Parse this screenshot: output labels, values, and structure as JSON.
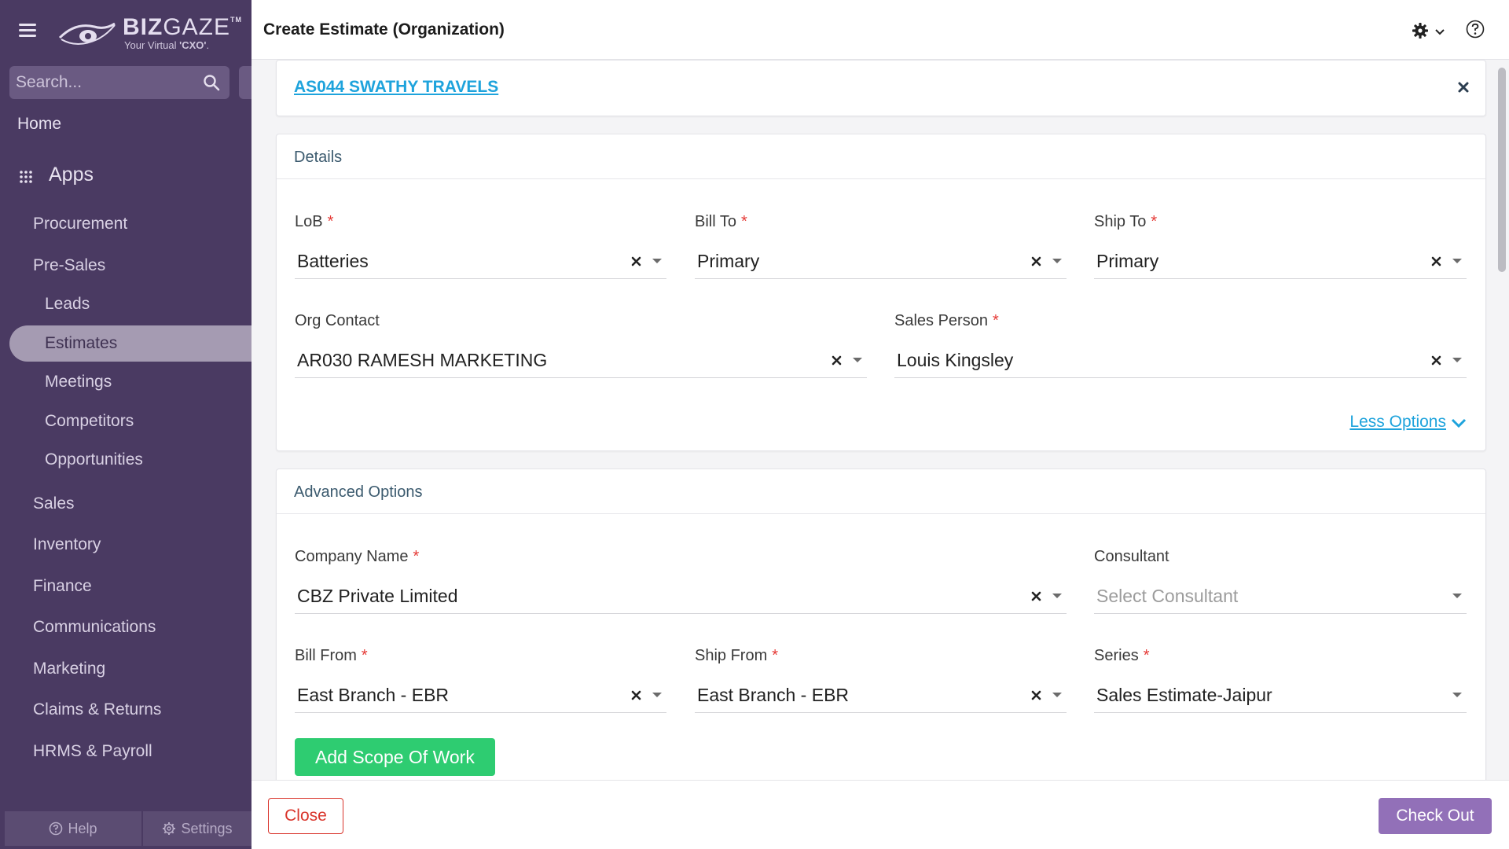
{
  "sidebar": {
    "brand_bold": "BIZ",
    "brand_light": "GAZE",
    "brand_tm": "TM",
    "tagline_prefix": "Your Virtual ",
    "tagline_emph": "'CXO'",
    "tagline_suffix": ".",
    "search_placeholder": "Search...",
    "home": "Home",
    "apps": "Apps",
    "items": {
      "procurement": "Procurement",
      "presales": "Pre-Sales",
      "leads": "Leads",
      "estimates": "Estimates",
      "meetings": "Meetings",
      "competitors": "Competitors",
      "opportunities": "Opportunities",
      "sales": "Sales",
      "inventory": "Inventory",
      "finance": "Finance",
      "communications": "Communications",
      "marketing": "Marketing",
      "claims": "Claims & Returns",
      "hrms": "HRMS & Payroll"
    },
    "footer": {
      "help": "Help",
      "settings": "Settings"
    }
  },
  "header": {
    "title": "Create Estimate (Organization)"
  },
  "account": {
    "link": "AS044 SWATHY TRAVELS"
  },
  "details": {
    "title": "Details",
    "lob": {
      "label": "LoB",
      "value": "Batteries"
    },
    "bill_to": {
      "label": "Bill To",
      "value": "Primary"
    },
    "ship_to": {
      "label": "Ship To",
      "value": "Primary"
    },
    "org_contact": {
      "label": "Org Contact",
      "value": "AR030 RAMESH MARKETING"
    },
    "sales_person": {
      "label": "Sales Person",
      "value": "Louis Kingsley"
    },
    "less_options": "Less Options"
  },
  "advanced": {
    "title": "Advanced Options",
    "company_name": {
      "label": "Company Name",
      "value": "CBZ Private Limited"
    },
    "consultant": {
      "label": "Consultant",
      "placeholder": "Select Consultant"
    },
    "bill_from": {
      "label": "Bill From",
      "value": "East Branch - EBR"
    },
    "ship_from": {
      "label": "Ship From",
      "value": "East Branch - EBR"
    },
    "series": {
      "label": "Series",
      "value": "Sales Estimate-Jaipur"
    },
    "add_scope": "Add Scope Of Work"
  },
  "footer": {
    "close": "Close",
    "checkout": "Check Out"
  },
  "colors": {
    "sidebar_bg": "#4a3a62",
    "active_item": "#a59bb2",
    "link": "#1ea3dc",
    "required": "#e53935",
    "add_scope": "#2ecc71",
    "checkout": "#9270b8",
    "close": "#d9342b"
  },
  "icons": [
    "hamburger-icon",
    "logo-eye-icon",
    "search-icon",
    "apps-grid-icon",
    "gear-icon",
    "chevron-down-icon",
    "help-circle-icon",
    "close-icon",
    "clear-icon",
    "caret-down-icon",
    "question-circle-icon"
  ]
}
